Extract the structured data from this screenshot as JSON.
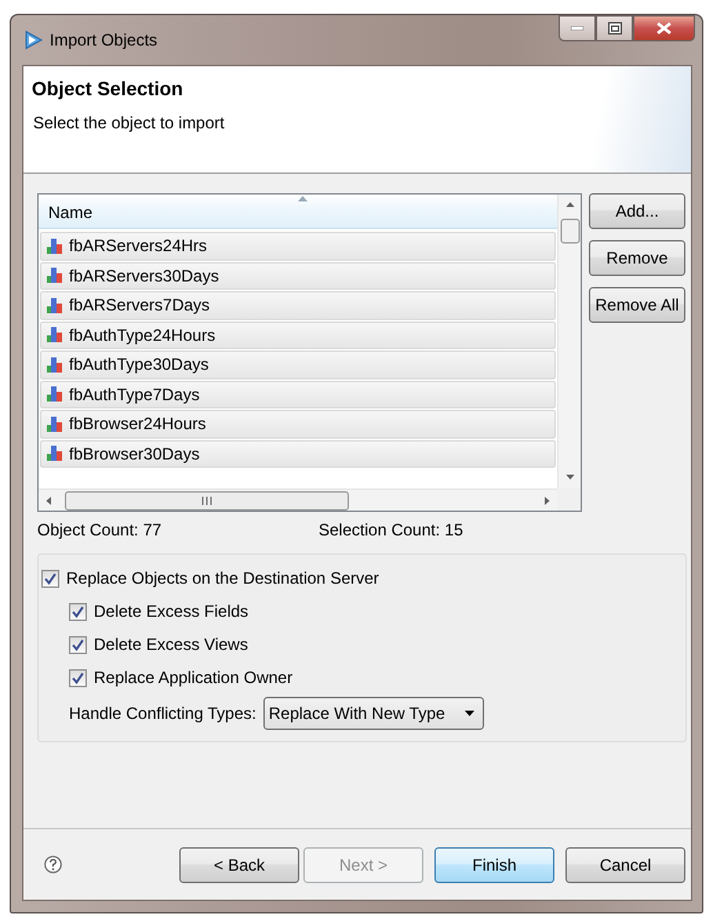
{
  "window": {
    "title": "Import Objects"
  },
  "header": {
    "title": "Object Selection",
    "description": "Select the object to import"
  },
  "object_list": {
    "columns": [
      "Name"
    ],
    "rows": [
      {
        "name": "fbARServers24Hrs",
        "selected": true
      },
      {
        "name": "fbARServers30Days",
        "selected": true
      },
      {
        "name": "fbARServers7Days",
        "selected": true
      },
      {
        "name": "fbAuthType24Hours",
        "selected": true
      },
      {
        "name": "fbAuthType30Days",
        "selected": true
      },
      {
        "name": "fbAuthType7Days",
        "selected": true
      },
      {
        "name": "fbBrowser24Hours",
        "selected": true
      },
      {
        "name": "fbBrowser30Days",
        "selected": true
      }
    ]
  },
  "list_buttons": [
    "Add...",
    "Remove",
    "Remove All"
  ],
  "object_count": "Object Count: 77",
  "selection_count": "Selection Count: 15",
  "options": [
    {
      "label": "Replace Objects on the Destination Server",
      "checked": true,
      "children": [
        {
          "label": "Delete Excess Fields",
          "checked": true
        },
        {
          "label": "Delete Excess Views",
          "checked": true
        },
        {
          "label": "Replace Application Owner",
          "checked": true
        }
      ]
    }
  ],
  "conflict": {
    "label": "Handle Conflicting Types:",
    "value": "Replace With New Type"
  },
  "footer_buttons": [
    {
      "label": "< Back",
      "disabled": false,
      "default": false
    },
    {
      "label": "Next >",
      "disabled": true,
      "default": false
    },
    {
      "label": "Finish",
      "disabled": false,
      "default": true
    },
    {
      "label": "Cancel",
      "disabled": false,
      "default": false
    }
  ]
}
